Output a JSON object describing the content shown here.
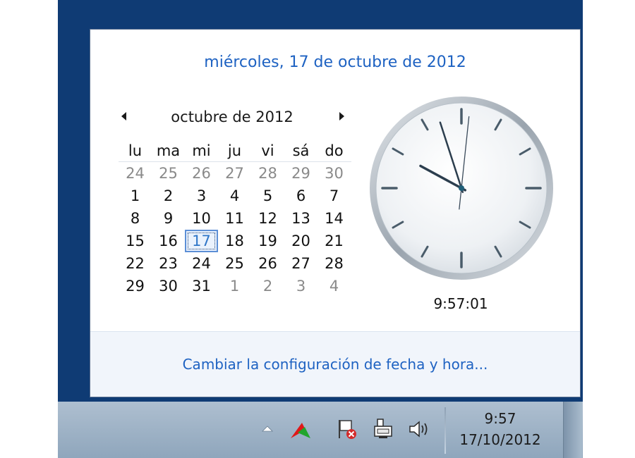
{
  "flyout": {
    "long_date": "miércoles, 17 de octubre de 2012",
    "calendar": {
      "month_title": "octubre de 2012",
      "weekdays": [
        "lu",
        "ma",
        "mi",
        "ju",
        "vi",
        "sá",
        "do"
      ],
      "weeks": [
        [
          "24",
          "25",
          "26",
          "27",
          "28",
          "29",
          "30"
        ],
        [
          "1",
          "2",
          "3",
          "4",
          "5",
          "6",
          "7"
        ],
        [
          "8",
          "9",
          "10",
          "11",
          "12",
          "13",
          "14"
        ],
        [
          "15",
          "16",
          "17",
          "18",
          "19",
          "20",
          "21"
        ],
        [
          "22",
          "23",
          "24",
          "25",
          "26",
          "27",
          "28"
        ],
        [
          "29",
          "30",
          "31",
          "1",
          "2",
          "3",
          "4"
        ]
      ],
      "selected_day": "17"
    },
    "clock": {
      "time": "9:57:01",
      "hour": 9,
      "minute": 57,
      "second": 1
    },
    "change_settings_link": "Cambiar la configuración de fecha y hora..."
  },
  "taskbar": {
    "tray_icons": [
      "show-hidden-icons-arrow-icon",
      "app-tray-icon",
      "action-center-flag-icon",
      "network-icon",
      "volume-icon"
    ],
    "time": "9:57",
    "date": "17/10/2012"
  },
  "colors": {
    "link": "#1e62c2",
    "desktop": "#0f3b74",
    "today_highlight": "#5c8fd6"
  }
}
